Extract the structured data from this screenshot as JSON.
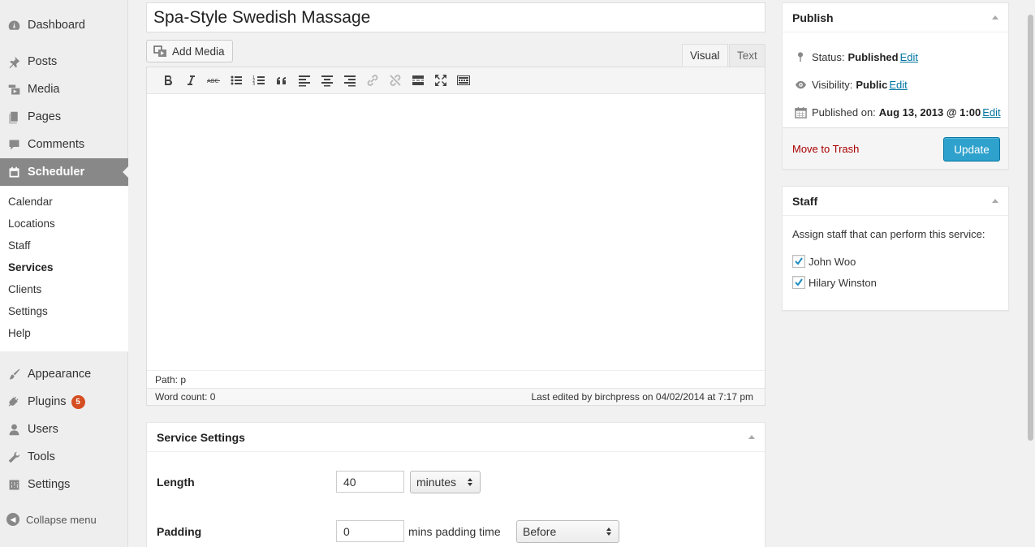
{
  "sidebar": {
    "menu": [
      {
        "label": "Dashboard",
        "icon": "dashboard-icon"
      },
      {
        "label": "Posts",
        "icon": "pin-icon"
      },
      {
        "label": "Media",
        "icon": "media-icon"
      },
      {
        "label": "Pages",
        "icon": "pages-icon"
      },
      {
        "label": "Comments",
        "icon": "comment-icon"
      },
      {
        "label": "Scheduler",
        "icon": "calendar-icon"
      }
    ],
    "submenu": [
      "Calendar",
      "Locations",
      "Staff",
      "Services",
      "Clients",
      "Settings",
      "Help"
    ],
    "lower_menu": [
      {
        "label": "Appearance",
        "icon": "brush-icon"
      },
      {
        "label": "Plugins",
        "icon": "plug-icon"
      },
      {
        "label": "Users",
        "icon": "user-icon"
      },
      {
        "label": "Tools",
        "icon": "wrench-icon"
      },
      {
        "label": "Settings",
        "icon": "settings-icon"
      }
    ],
    "plugins_badge": "5",
    "collapse_label": "Collapse menu"
  },
  "editor": {
    "title": "Spa-Style Swedish Massage",
    "add_media_label": "Add Media",
    "tab_visual": "Visual",
    "tab_text": "Text",
    "path": "Path: p",
    "word_count": "Word count: 0",
    "last_edited": "Last edited by birchpress on 04/02/2014 at 7:17 pm"
  },
  "service_settings": {
    "title": "Service Settings",
    "length_label": "Length",
    "length_value": "40",
    "length_unit": "minutes",
    "padding_label": "Padding",
    "padding_value": "0",
    "padding_text": "mins padding time",
    "padding_position": "Before"
  },
  "publish": {
    "title": "Publish",
    "status_label": "Status:",
    "status_value": "Published",
    "visibility_label": "Visibility:",
    "visibility_value": "Public",
    "published_label": "Published on:",
    "published_value": "Aug 13, 2013 @ 1:00",
    "edit_label": "Edit",
    "trash_label": "Move to Trash",
    "update_label": "Update"
  },
  "staff": {
    "title": "Staff",
    "description": "Assign staff that can perform this service:",
    "members": [
      "John Woo",
      "Hilary Winston"
    ]
  },
  "colors": {
    "accent": "#2ea2cc",
    "link": "#0074a2",
    "active_menu": "#888888",
    "trash": "#aa0000",
    "badge": "#d54e21"
  }
}
